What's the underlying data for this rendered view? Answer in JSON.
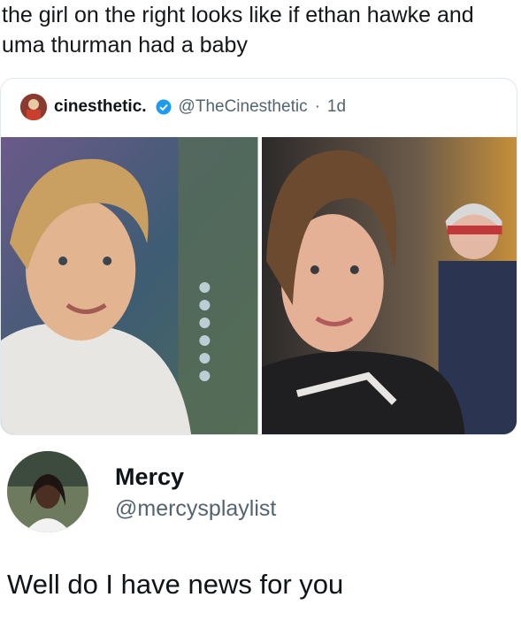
{
  "caption": "the girl on the right looks like if ethan hawke and uma thurman had a baby",
  "quoted_tweet": {
    "display_name": "cinesthetic.",
    "handle": "@TheCinesthetic",
    "separator": "·",
    "time": "1d",
    "avatar_icon": "film-avatar",
    "verified_icon": "verified-badge-icon",
    "images": [
      "blonde-woman-smiling",
      "curly-haired-woman-smiling"
    ]
  },
  "reply": {
    "display_name": "Mercy",
    "handle": "@mercysplaylist",
    "text": "Well do I have news for you",
    "avatar_icon": "profile-photo"
  },
  "colors": {
    "text": "#0f1419",
    "secondary": "#536471",
    "verified": "#1d9bf0",
    "border": "#e1e8ed"
  }
}
